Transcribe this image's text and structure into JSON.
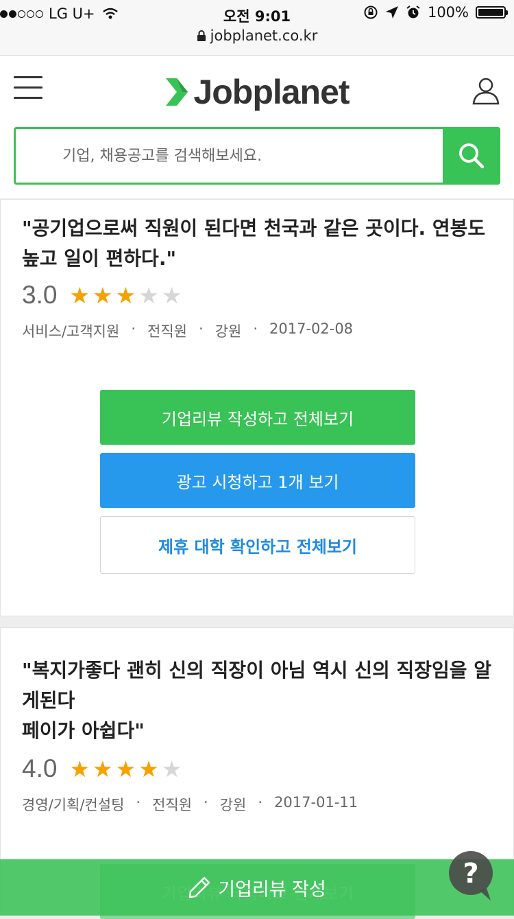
{
  "status_bar": {
    "carrier": "LG U+",
    "time": "오전 9:01",
    "battery": "100%",
    "url": "jobplanet.co.kr"
  },
  "header": {
    "logo_text": "Jobplanet",
    "search_placeholder": "기업, 채용공고를 검색해보세요."
  },
  "reviews": [
    {
      "quote": "\"공기업으로써 직원이 된다면 천국과 같은 곳이다. 연봉도 높고 일이 편하다.\"",
      "score": "3.0",
      "stars": 3,
      "category": "서비스/고객지원",
      "status": "전직원",
      "region": "강원",
      "date": "2017-02-08"
    },
    {
      "quote": "\"복지가좋다 괜히 신의 직장이 아님 역시 신의 직장임을 알게된다\n페이가 아쉽다\"",
      "score": "4.0",
      "stars": 4,
      "category": "경영/기획/컨설팅",
      "status": "전직원",
      "region": "강원",
      "date": "2017-01-11"
    }
  ],
  "actions": {
    "write_review": "기업리뷰 작성하고 전체보기",
    "watch_ad": "광고 시청하고 1개 보기",
    "university": "제휴 대학 확인하고 전체보기"
  },
  "bottom_bar": {
    "label": "기업리뷰 작성"
  },
  "colors": {
    "brand_green": "#39c255",
    "ad_blue": "#2799ec",
    "link_blue": "#1f8ae0",
    "star": "#f5a200"
  }
}
